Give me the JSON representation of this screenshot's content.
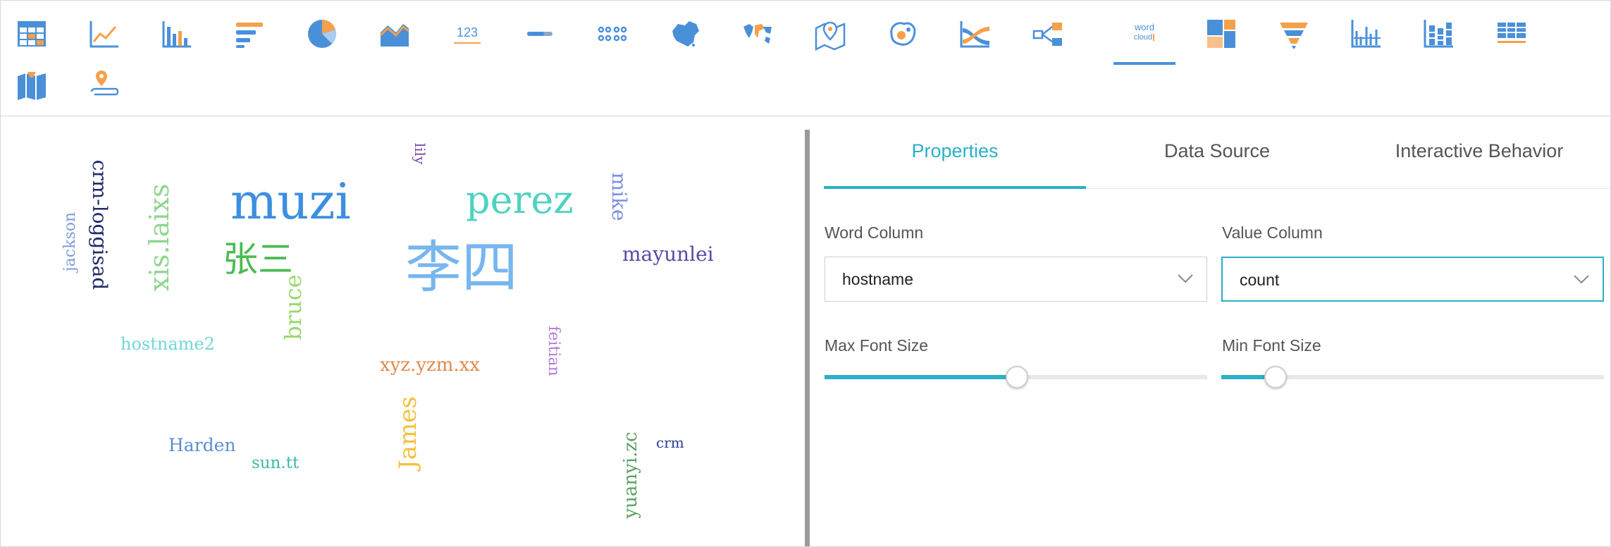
{
  "toolbar": {
    "icons": [
      "table-icon",
      "line-chart-icon",
      "bar-chart-icon",
      "horizontal-bar-icon",
      "pie-chart-icon",
      "area-chart-icon",
      "number-kpi-icon",
      "progress-bar-icon",
      "sankey-icon",
      "china-map-icon",
      "world-map-icon",
      "location-map-icon",
      "bubble-map-icon",
      "flow-chart-icon",
      "relation-graph-icon",
      "word-cloud-icon",
      "treemap-icon",
      "funnel-icon",
      "grouped-column-icon",
      "stacked-column-icon",
      "cross-table-icon",
      "pin-map-icon",
      "geo-point-icon"
    ],
    "active": "word-cloud-icon",
    "word_cloud_icon_line1": "word",
    "word_cloud_icon_line2": "cloud",
    "number_icon_text": "123"
  },
  "cloud": {
    "words": [
      {
        "text": "muzi",
        "color": "#3d8fdf"
      },
      {
        "text": "perez",
        "color": "#4fd1c1"
      },
      {
        "text": "李四",
        "color": "#78b6ee"
      },
      {
        "text": "张三",
        "color": "#4cbb52"
      },
      {
        "text": "xis.laixs",
        "color": "#8fd690"
      },
      {
        "text": "crm-loggisad",
        "color": "#1f2a6a"
      },
      {
        "text": "jackson",
        "color": "#7a9bdc"
      },
      {
        "text": "lily",
        "color": "#7a4aa8"
      },
      {
        "text": "mike",
        "color": "#7a8fe0"
      },
      {
        "text": "mayunlei",
        "color": "#5a4aa8"
      },
      {
        "text": "bruce",
        "color": "#9bd86c"
      },
      {
        "text": "hostname2",
        "color": "#72d6d6"
      },
      {
        "text": "feitian",
        "color": "#b27ad8"
      },
      {
        "text": "xyz.yzm.xx",
        "color": "#e08a4a"
      },
      {
        "text": "James",
        "color": "#f5c13a"
      },
      {
        "text": "Harden",
        "color": "#5a8fd0"
      },
      {
        "text": "sun.tt",
        "color": "#3ab8a8"
      },
      {
        "text": "yuanyi.zc",
        "color": "#5aa060"
      },
      {
        "text": "crm",
        "color": "#2a3a9a"
      }
    ]
  },
  "tabs": [
    {
      "label": "Properties",
      "active": true
    },
    {
      "label": "Data Source",
      "active": false
    },
    {
      "label": "Interactive Behavior",
      "active": false
    }
  ],
  "properties": {
    "word_column": {
      "label": "Word Column",
      "value": "hostname"
    },
    "value_column": {
      "label": "Value Column",
      "value": "count"
    },
    "max_font_size": {
      "label": "Max Font Size",
      "value_fraction": 0.5
    },
    "min_font_size": {
      "label": "Min Font Size",
      "value_fraction": 0.14
    }
  },
  "colors": {
    "accent": "#2bb0c8",
    "icon_blue": "#4a90d9",
    "icon_orange": "#f5a04a"
  }
}
